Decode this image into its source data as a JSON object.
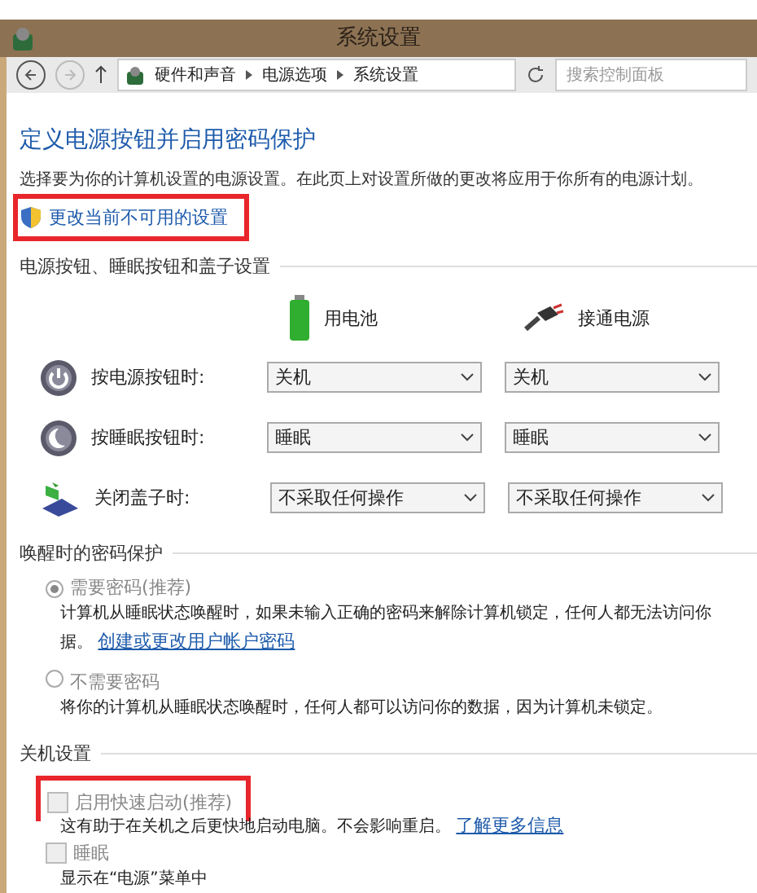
{
  "window": {
    "title": "系统设置"
  },
  "nav": {
    "breadcrumb": [
      "硬件和声音",
      "电源选项",
      "系统设置"
    ],
    "search": {
      "placeholder": "搜索控制面板"
    }
  },
  "page": {
    "heading": "定义电源按钮并启用密码保护",
    "description": "选择要为你的计算机设置的电源设置。在此页上对设置所做的更改将应用于你所有的电源计划。",
    "admin_link": "更改当前不可用的设置"
  },
  "buttons_section": {
    "title": "电源按钮、睡眠按钮和盖子设置",
    "columns": [
      {
        "kind": "battery",
        "label": "用电池"
      },
      {
        "kind": "plug",
        "label": "接通电源"
      }
    ],
    "rows": [
      {
        "kind": "power",
        "label": "按电源按钮时:",
        "battery": "关机",
        "plugged": "关机"
      },
      {
        "kind": "sleep",
        "label": "按睡眠按钮时:",
        "battery": "睡眠",
        "plugged": "睡眠"
      },
      {
        "kind": "lid",
        "label": "关闭盖子时:",
        "battery": "不采取任何操作",
        "plugged": "不采取任何操作"
      }
    ]
  },
  "password_section": {
    "title": "唤醒时的密码保护",
    "options": [
      {
        "label": "需要密码(推荐)",
        "selected": true,
        "lines": [
          "计算机从睡眠状态唤醒时，如果未输入正确的密码来解除计算机锁定，任何人都无法访问你",
          "据。"
        ],
        "link": "创建或更改用户帐户密码"
      },
      {
        "label": "不需要密码",
        "selected": false,
        "lines": [
          "将你的计算机从睡眠状态唤醒时，任何人都可以访问你的数据，因为计算机未锁定。"
        ]
      }
    ]
  },
  "shutdown_section": {
    "title": "关机设置",
    "options": [
      {
        "label": "启用快速启动(推荐)",
        "checked": false,
        "description": "这有助于在关机之后更快地启动电脑。不会影响重启。",
        "link": "了解更多信息"
      },
      {
        "label": "睡眠",
        "checked": false,
        "description": "显示在“电源”菜单中"
      }
    ]
  }
}
